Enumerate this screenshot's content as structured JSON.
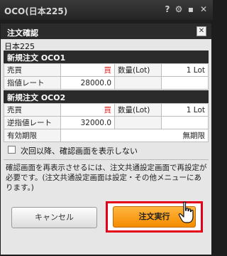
{
  "window": {
    "title": "OCO(日本225)"
  },
  "titlebar_icons": [
    "help-icon",
    "gear-icon",
    "settings-icon",
    "close-icon"
  ],
  "dialog": {
    "title": "注文確認",
    "symbol": "日本225",
    "order1": {
      "header": "新規注文 OCO1",
      "rows": [
        {
          "label": "売買",
          "value": "買",
          "label2": "数量(Lot)",
          "value2": "1 Lot"
        },
        {
          "label": "指値レート",
          "value": "28000.0",
          "label2": "",
          "value2": ""
        }
      ]
    },
    "order2": {
      "header": "新規注文 OCO2",
      "rows": [
        {
          "label": "売買",
          "value": "買",
          "label2": "数量(Lot)",
          "value2": "1 Lot"
        },
        {
          "label": "逆指値レート",
          "value": "32000.0",
          "label2": "",
          "value2": ""
        }
      ],
      "expiry_label": "有効期限",
      "expiry_value": "無期限"
    },
    "checkbox_label": "次回以降、確認画面を表示しない",
    "checkbox_checked": false,
    "note": "確認画面を再表示させるには、注文共通設定画面で再設定が必要です。(注文共通設定画面は設定・その他メニューにあります。)",
    "cancel_label": "キャンセル",
    "execute_label": "注文実行"
  },
  "colors": {
    "buy": "#e02020",
    "accent": "#f48c00",
    "highlight": "#e5001a"
  }
}
